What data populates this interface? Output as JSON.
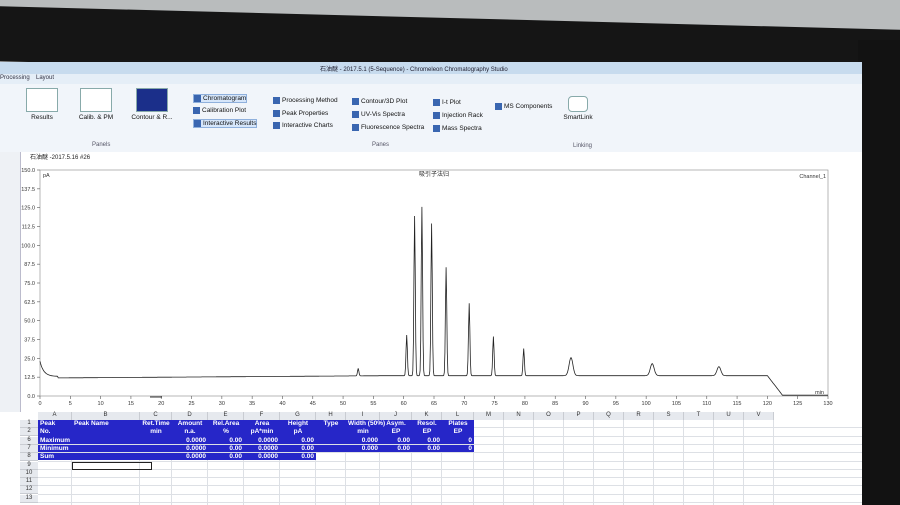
{
  "window": {
    "title": "石油醚 - 2017.5.1 (5-Sequence) - Chromeleon Chromatography Studio"
  },
  "menu": [
    "Processing",
    "Layout"
  ],
  "ribbon": {
    "buttons": [
      {
        "label": "Results"
      },
      {
        "label": "Calib. & PM"
      },
      {
        "label": "Contour & R..."
      },
      {
        "label": "SmartLink"
      }
    ],
    "items_col1": [
      "Chromatogram",
      "Calibration Plot",
      "Interactive Results"
    ],
    "items_col2": [
      "Processing Method",
      "Peak Properties",
      "Interactive Charts"
    ],
    "items_col3": [
      "Contour/3D Plot",
      "UV-Vis Spectra",
      "Fluorescence Spectra"
    ],
    "items_col4": [
      "I-t Plot",
      "Injection Rack",
      "Mass Spectra"
    ],
    "items_col5": [
      "MS Components"
    ],
    "groups": [
      "Panels",
      "Panes",
      "Linking"
    ]
  },
  "chart_tab": "石油醚 -2017.5.16 #26",
  "chart_data": {
    "type": "line",
    "title": "吸引子法归",
    "ylabel": "pA",
    "xlabel": "min",
    "legend": "Channel_1",
    "xlim": [
      0,
      130
    ],
    "ylim": [
      0,
      150
    ],
    "xticks": [
      0,
      5,
      10,
      15,
      20,
      25,
      30,
      35,
      40,
      45,
      50,
      55,
      60,
      65,
      70,
      75,
      80,
      85,
      90,
      95,
      100,
      105,
      110,
      115,
      120,
      125,
      130
    ],
    "yticks": [
      0.0,
      12.5,
      25.0,
      37.5,
      50.0,
      62.5,
      75.0,
      87.5,
      100.0,
      112.5,
      125.0,
      137.5,
      150.0
    ],
    "baseline": 13,
    "peaks": [
      {
        "x": 52.5,
        "y": 18
      },
      {
        "x": 60.5,
        "y": 40
      },
      {
        "x": 61.8,
        "y": 119
      },
      {
        "x": 63.0,
        "y": 125
      },
      {
        "x": 64.6,
        "y": 114
      },
      {
        "x": 67.0,
        "y": 85
      },
      {
        "x": 70.8,
        "y": 61
      },
      {
        "x": 74.8,
        "y": 39
      },
      {
        "x": 79.8,
        "y": 31
      },
      {
        "x": 87.6,
        "y": 25
      },
      {
        "x": 101.0,
        "y": 21
      },
      {
        "x": 112.0,
        "y": 19
      }
    ],
    "drop_at": 120,
    "drop_to": 0.5
  },
  "sheet": {
    "columns": [
      "A",
      "B",
      "C",
      "D",
      "E",
      "F",
      "G",
      "H",
      "I",
      "J",
      "K",
      "L",
      "M",
      "N",
      "O",
      "P",
      "Q",
      "R",
      "S",
      "T",
      "U",
      "V"
    ],
    "header_row1": [
      "Peak",
      "Peak Name",
      "Ret.Time",
      "Amount",
      "Rel.Area",
      "Area",
      "Height",
      "Type",
      "Width (50%)",
      "Asym.",
      "Resol.",
      "Plates"
    ],
    "header_row2": [
      "No.",
      "",
      "min",
      "n.a.",
      "%",
      "pA*min",
      "pA",
      "",
      "min",
      "EP",
      "EP",
      "EP"
    ],
    "row_numbers": [
      "1",
      "2",
      "6",
      "7",
      "8",
      "9",
      "10",
      "11",
      "12",
      "13"
    ],
    "summary": [
      {
        "label": "Maximum",
        "amount": "0.0000",
        "rel_area": "0.00",
        "area": "0.0000",
        "height": "0.00",
        "width": "0.000",
        "asym": "0.00",
        "resol": "0.00",
        "plates": "0"
      },
      {
        "label": "Minimum",
        "amount": "0.0000",
        "rel_area": "0.00",
        "area": "0.0000",
        "height": "0.00",
        "width": "0.000",
        "asym": "0.00",
        "resol": "0.00",
        "plates": "0"
      },
      {
        "label": "Sum",
        "amount": "0.0000",
        "rel_area": "0.00",
        "area": "0.0000",
        "height": "0.00",
        "width": "",
        "asym": "",
        "resol": "",
        "plates": ""
      }
    ]
  }
}
